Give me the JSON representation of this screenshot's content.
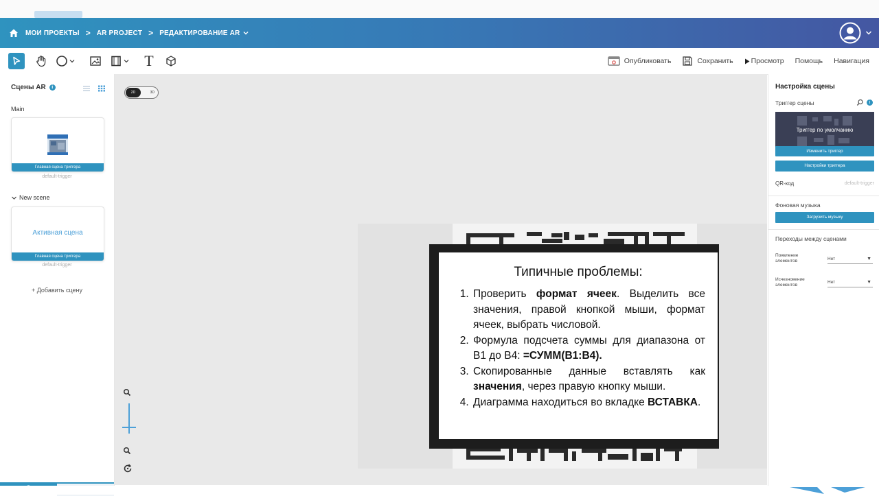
{
  "navbar": {
    "crumbs": [
      "МОИ ПРОЕКТЫ",
      "AR PROJECT",
      "РЕДАКТИРОВАНИЕ AR"
    ],
    "separator": ">",
    "accent_start": "#2f93bf",
    "accent_end": "#4457a2"
  },
  "toolbar": {
    "tools": [
      "select-icon",
      "hand-icon",
      "circle-icon",
      "image-icon",
      "frame-icon",
      "text-icon",
      "cube-icon"
    ],
    "text_tool": "T",
    "actions": {
      "publish": "Опубликовать",
      "save": "Сохранить",
      "preview": "Просмотр",
      "help": "Помощь",
      "navigation": "Навигация"
    }
  },
  "left_panel": {
    "title": "Сцены AR",
    "info": "i",
    "groups": [
      {
        "label": "Main",
        "card_bar": "Главная сцена триггера",
        "sub": "default-trigger"
      },
      {
        "label": "New scene",
        "card_text": "Активная сцена",
        "card_bar": "Главная сцена триггера",
        "sub": "default-trigger"
      }
    ],
    "add_scene": "+ Добавить сцену"
  },
  "canvas": {
    "toggle_on": "2D",
    "toggle_off": "3D",
    "slide": {
      "title": "Типичные проблемы:",
      "items": [
        {
          "before": "Проверить ",
          "bold": "формат ячеек",
          "after": ". Выделить все значения, правой кнопкой мыши, формат ячеек, выбрать числовой."
        },
        {
          "before": "Формула подсчета суммы для диапазона от B1 до B4: ",
          "bold": "=СУММ(B1:B4).",
          "after": ""
        },
        {
          "before": "Скопированные данные вставлять как ",
          "bold": "значения",
          "after": ", через правую кнопку мыши."
        },
        {
          "before": "Диаграмма находиться во вкладке ",
          "bold": "ВСТАВКА",
          "after": "."
        }
      ]
    }
  },
  "right_panel": {
    "title": "Настройка сцены",
    "trigger_label": "Триггер сцены",
    "trigger_thumb_text": "Триггер по умолчанию",
    "change_trigger": "Изменить триггер",
    "trigger_settings": "Настройки триггера",
    "qr_label": "QR-код",
    "qr_value": "default-trigger",
    "music_label": "Фоновая музыка",
    "upload_music": "Загрузить музыку",
    "transitions_label": "Переходы между сценами",
    "appear_label": "Появление элементов",
    "appear_value": "Нет",
    "disappear_label": "Исчезновение элементов",
    "disappear_value": "Нет"
  }
}
